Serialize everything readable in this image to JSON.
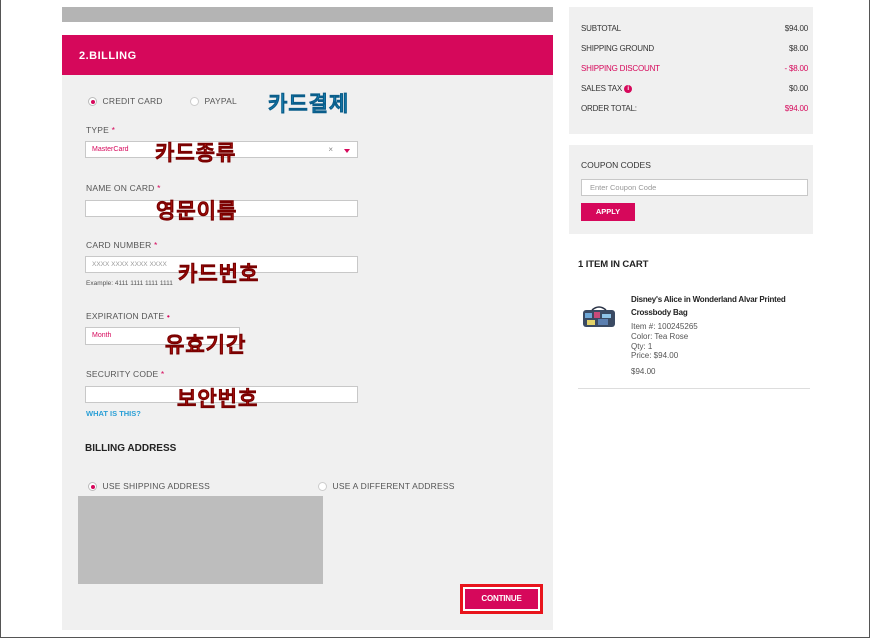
{
  "billing": {
    "header": "2.BILLING",
    "payment_methods": [
      {
        "label": "CREDIT CARD",
        "selected": true
      },
      {
        "label": "PAYPAL",
        "selected": false
      }
    ],
    "type_label": "TYPE",
    "type_value": "MasterCard",
    "name_label": "NAME ON CARD",
    "card_number_label": "CARD NUMBER",
    "card_number_placeholder": "XXXX XXXX XXXX XXXX",
    "card_number_example": "Example: 4111 1111 1111 1111",
    "expiration_label": "EXPIRATION DATE",
    "month_placeholder": "Month",
    "security_label": "SECURITY CODE",
    "what_is_this": "WHAT IS THIS?",
    "billing_address_title": "BILLING ADDRESS",
    "address_options": [
      {
        "label": "USE SHIPPING ADDRESS",
        "selected": true
      },
      {
        "label": "USE A DIFFERENT ADDRESS",
        "selected": false
      }
    ],
    "continue_label": "CONTINUE",
    "required_mark": "*",
    "clear_mark": "×"
  },
  "annotations": {
    "card_payment": "카드결제",
    "card_type": "카드종류",
    "english_name": "영문이름",
    "card_number": "카드번호",
    "expiry": "유효기간",
    "security_code": "보안번호"
  },
  "summary": {
    "rows": [
      {
        "label": "SUBTOTAL",
        "value": "$94.00",
        "highlight": false
      },
      {
        "label": "SHIPPING GROUND",
        "value": "$8.00",
        "highlight": false
      },
      {
        "label": "SHIPPING DISCOUNT",
        "value": "- $8.00",
        "highlight": true
      },
      {
        "label": "SALES TAX",
        "value": "$0.00",
        "highlight": false
      },
      {
        "label": "ORDER TOTAL:",
        "value": "$94.00",
        "highlight": false
      }
    ]
  },
  "coupon": {
    "title": "COUPON CODES",
    "placeholder": "Enter Coupon Code",
    "apply_label": "APPLY"
  },
  "cart": {
    "title": "1 ITEM IN CART",
    "item_name": "Disney's Alice in Wonderland Alvar Printed Crossbody Bag",
    "item_number": "Item #: 100245265",
    "color": "Color: Tea Rose",
    "qty": "Qty: 1",
    "price": "Price: $94.00",
    "line_total": "$94.00"
  },
  "colors": {
    "accent": "#d6085b",
    "annotation_red": "#e0281c",
    "annotation_blue": "#2ab0e8"
  }
}
